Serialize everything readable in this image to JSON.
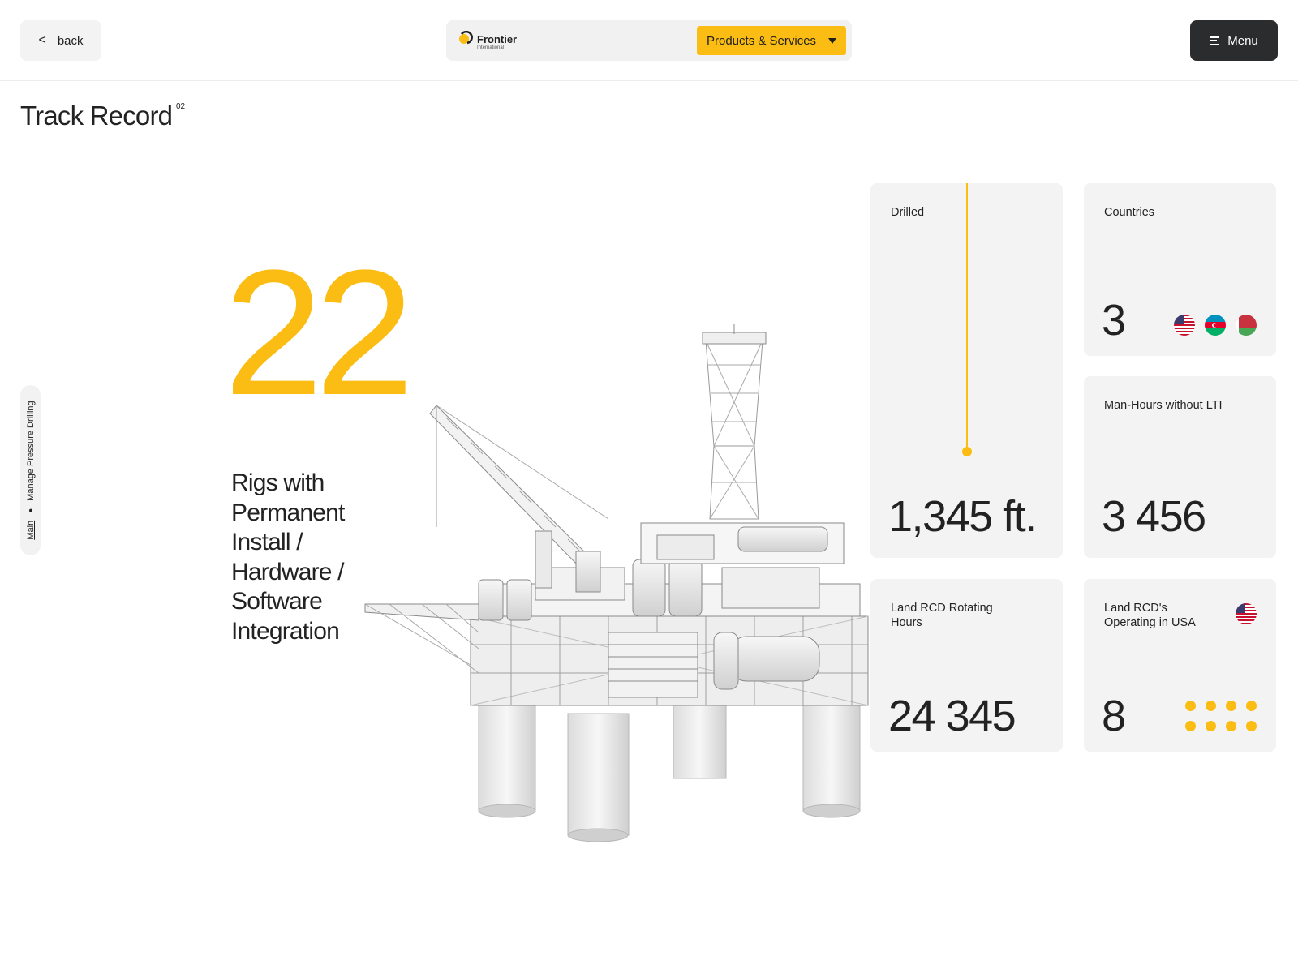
{
  "header": {
    "back_label": "back",
    "brand_name": "Frontier",
    "brand_sub": "International",
    "products_label": "Products & Services",
    "menu_label": "Menu"
  },
  "page": {
    "title": "Track Record",
    "number": "02"
  },
  "breadcrumb": {
    "items": [
      "Main",
      "Manage Pressure Drilling"
    ]
  },
  "hero": {
    "value": "22",
    "caption": "Rigs with Permanent Install / Hardware / Software Integration"
  },
  "stats": {
    "drilled": {
      "label": "Drilled",
      "value": "1,345 ft."
    },
    "countries": {
      "label": "Countries",
      "value": "3",
      "flags": [
        "usa-flag-icon",
        "azerbaijan-flag-icon",
        "belarus-flag-icon"
      ]
    },
    "manhours": {
      "label": "Man-Hours without LTI",
      "value": "3 456"
    },
    "rotating": {
      "label": "Land RCD Rotating Hours",
      "value": "24 345"
    },
    "usa": {
      "label": "Land RCD's Operating in USA",
      "value": "8",
      "dots": 8
    }
  },
  "colors": {
    "accent": "#fbbd13",
    "dark": "#2b2c2e",
    "card_bg": "#f3f3f3"
  }
}
